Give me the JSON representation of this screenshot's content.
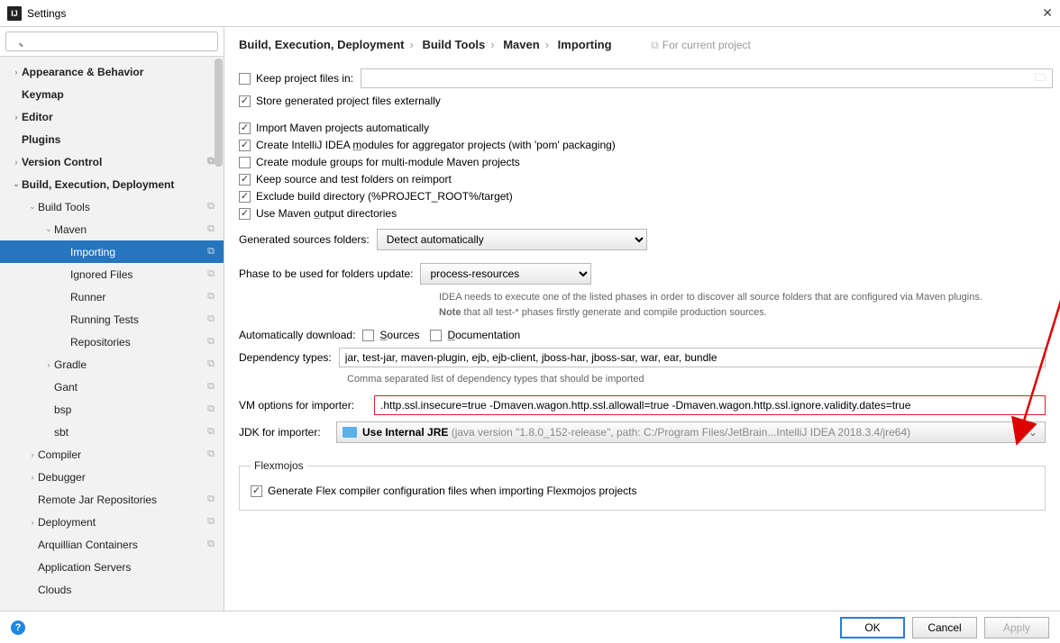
{
  "window": {
    "title": "Settings"
  },
  "search": {
    "placeholder": ""
  },
  "tree": {
    "items": [
      {
        "label": "Appearance & Behavior",
        "lvl": 0,
        "bold": true,
        "chev": "›",
        "copy": false
      },
      {
        "label": "Keymap",
        "lvl": 0,
        "bold": true,
        "chev": "",
        "copy": false
      },
      {
        "label": "Editor",
        "lvl": 0,
        "bold": true,
        "chev": "›",
        "copy": false
      },
      {
        "label": "Plugins",
        "lvl": 0,
        "bold": true,
        "chev": "",
        "copy": false
      },
      {
        "label": "Version Control",
        "lvl": 0,
        "bold": true,
        "chev": "›",
        "copy": true
      },
      {
        "label": "Build, Execution, Deployment",
        "lvl": 0,
        "bold": true,
        "chev": "⌄",
        "copy": false
      },
      {
        "label": "Build Tools",
        "lvl": 1,
        "bold": false,
        "chev": "⌄",
        "copy": true
      },
      {
        "label": "Maven",
        "lvl": 2,
        "bold": false,
        "chev": "⌄",
        "copy": true
      },
      {
        "label": "Importing",
        "lvl": 3,
        "bold": false,
        "chev": "",
        "copy": true,
        "selected": true
      },
      {
        "label": "Ignored Files",
        "lvl": 3,
        "bold": false,
        "chev": "",
        "copy": true
      },
      {
        "label": "Runner",
        "lvl": 3,
        "bold": false,
        "chev": "",
        "copy": true
      },
      {
        "label": "Running Tests",
        "lvl": 3,
        "bold": false,
        "chev": "",
        "copy": true
      },
      {
        "label": "Repositories",
        "lvl": 3,
        "bold": false,
        "chev": "",
        "copy": true
      },
      {
        "label": "Gradle",
        "lvl": 2,
        "bold": false,
        "chev": "›",
        "copy": true
      },
      {
        "label": "Gant",
        "lvl": 2,
        "bold": false,
        "chev": "",
        "copy": true
      },
      {
        "label": "bsp",
        "lvl": 2,
        "bold": false,
        "chev": "",
        "copy": true
      },
      {
        "label": "sbt",
        "lvl": 2,
        "bold": false,
        "chev": "",
        "copy": true
      },
      {
        "label": "Compiler",
        "lvl": 1,
        "bold": false,
        "chev": "›",
        "copy": true
      },
      {
        "label": "Debugger",
        "lvl": 1,
        "bold": false,
        "chev": "›",
        "copy": false
      },
      {
        "label": "Remote Jar Repositories",
        "lvl": 1,
        "bold": false,
        "chev": "",
        "copy": true
      },
      {
        "label": "Deployment",
        "lvl": 1,
        "bold": false,
        "chev": "›",
        "copy": true
      },
      {
        "label": "Arquillian Containers",
        "lvl": 1,
        "bold": false,
        "chev": "",
        "copy": true
      },
      {
        "label": "Application Servers",
        "lvl": 1,
        "bold": false,
        "chev": "",
        "copy": false
      },
      {
        "label": "Clouds",
        "lvl": 1,
        "bold": false,
        "chev": "",
        "copy": false
      }
    ]
  },
  "breadcrumb": {
    "p0": "Build, Execution, Deployment",
    "p1": "Build Tools",
    "p2": "Maven",
    "p3": "Importing",
    "project_hint": "For current project"
  },
  "opts": {
    "keep_files": "Keep project files in:",
    "keep_files_value": "",
    "store_ext": "Store generated project files externally",
    "import_auto": "Import Maven projects automatically",
    "create_modules": "Create IntelliJ IDEA modules for aggregator projects (with 'pom' packaging)",
    "create_groups": "Create module groups for multi-module Maven projects",
    "keep_src": "Keep source and test folders on reimport",
    "exclude_build": "Exclude build directory (%PROJECT_ROOT%/target)",
    "use_output": "Use Maven output directories",
    "gen_src_label": "Generated sources folders:",
    "gen_src_value": "Detect automatically",
    "phase_label": "Phase to be used for folders update:",
    "phase_value": "process-resources",
    "phase_hint_1": "IDEA needs to execute one of the listed phases in order to discover all source folders that are configured via Maven plugins.",
    "phase_hint_2_bold": "Note",
    "phase_hint_2_rest": " that all test-* phases firstly generate and compile production sources.",
    "auto_dl_label": "Automatically download:",
    "auto_dl_sources": "Sources",
    "auto_dl_docs": "Documentation",
    "dep_types_label": "Dependency types:",
    "dep_types_value": "jar, test-jar, maven-plugin, ejb, ejb-client, jboss-har, jboss-sar, war, ear, bundle",
    "dep_types_hint": "Comma separated list of dependency types that should be imported",
    "vm_label": "VM options for importer:",
    "vm_value": ".http.ssl.insecure=true -Dmaven.wagon.http.ssl.allowall=true -Dmaven.wagon.http.ssl.ignore.validity.dates=true",
    "jdk_label": "JDK for importer:",
    "jdk_value_bold": "Use Internal JRE",
    "jdk_value_rest": " (java version \"1.8.0_152-release\", path: C:/Program Files/JetBrain...IntelliJ IDEA 2018.3.4/jre64)",
    "flex_legend": "Flexmojos",
    "flex_gen": "Generate Flex compiler configuration files when importing Flexmojos projects"
  },
  "footer": {
    "ok": "OK",
    "cancel": "Cancel",
    "apply": "Apply"
  }
}
